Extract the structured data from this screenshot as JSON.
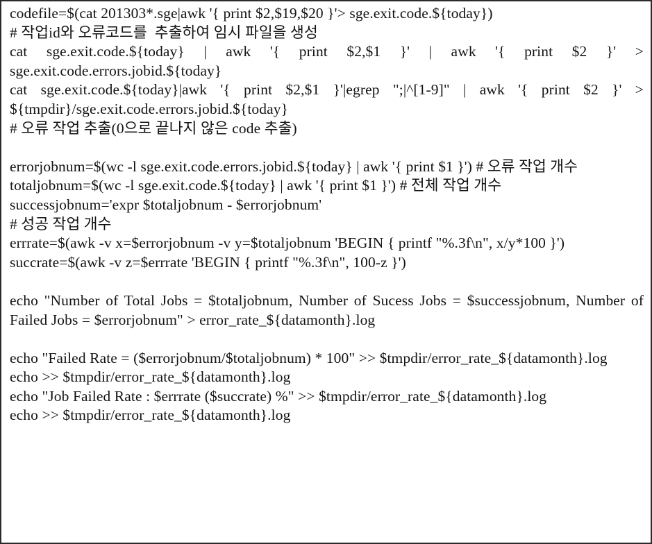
{
  "document": {
    "type": "scanned-code-listing",
    "language": "shell",
    "border_color": "#2b2b2b",
    "background_color": "#ffffff",
    "text_color": "#141414"
  },
  "code": {
    "lines": [
      {
        "id": "line-1",
        "kind": "command",
        "justified": true,
        "text": "codefile=$(cat 201303*.sge|awk '{ print $2,$19,$20 }'> sge.exit.code.${today})"
      },
      {
        "id": "line-2",
        "kind": "comment",
        "justified": false,
        "text": "# 작업id와 오류코드를  추출하여 임시 파일을 생성"
      },
      {
        "id": "line-3",
        "kind": "command",
        "justified": true,
        "text": "cat   sge.exit.code.${today}  |  awk  '{  print  $2,$1  }'  |  awk  '{  print  $2  }'  > sge.exit.code.errors.jobid.${today}"
      },
      {
        "id": "line-4",
        "kind": "command",
        "justified": true,
        "text": "cat  sge.exit.code.${today}|awk  '{  print  $2,$1  }'|egrep  \";|^[1-9]\"  |  awk  '{  print  $2  }'  > ${tmpdir}/sge.exit.code.errors.jobid.${today}"
      },
      {
        "id": "line-5",
        "kind": "comment",
        "justified": false,
        "text": "# 오류 작업 추출(0으로 끝나지 않은 code 추출)"
      },
      {
        "id": "line-6",
        "kind": "blank",
        "justified": false,
        "text": ""
      },
      {
        "id": "line-7",
        "kind": "command",
        "justified": true,
        "text": "errorjobnum=$(wc  -l  sge.exit.code.errors.jobid.${today}  |  awk  '{  print  $1  }')  # 오류 작업 개수"
      },
      {
        "id": "line-8",
        "kind": "command",
        "justified": true,
        "text": "totaljobnum=$(wc  -l  sge.exit.code.${today}  |  awk  '{  print  $1  }')  # 전체 작업 개수"
      },
      {
        "id": "line-9",
        "kind": "command",
        "justified": false,
        "text": "successjobnum='expr $totaljobnum - $errorjobnum'"
      },
      {
        "id": "line-10",
        "kind": "comment",
        "justified": false,
        "text": "# 성공 작업 개수"
      },
      {
        "id": "line-11",
        "kind": "command",
        "justified": true,
        "text": "errrate=$(awk  -v  x=$errorjobnum  -v  y=$totaljobnum  'BEGIN  {  printf  \"%.3f\\n\", x/y*100 }')"
      },
      {
        "id": "line-12",
        "kind": "command",
        "justified": false,
        "text": "succrate=$(awk -v z=$errrate 'BEGIN { printf \"%.3f\\n\", 100-z }')"
      },
      {
        "id": "line-13",
        "kind": "blank",
        "justified": false,
        "text": ""
      },
      {
        "id": "line-14",
        "kind": "command",
        "justified": true,
        "text": "echo  \"Number  of  Total  Jobs  =  $totaljobnum,  Number  of  Sucess  Jobs  = $successjobnum,  Number  of  Failed  Jobs  =  $errorjobnum\"  > error_rate_${datamonth}.log"
      },
      {
        "id": "line-15",
        "kind": "blank",
        "justified": false,
        "text": ""
      },
      {
        "id": "line-16",
        "kind": "command",
        "justified": true,
        "text": "echo  \"Failed  Rate  =  ($errorjobnum/$totaljobnum)  *  100\"  >> $tmpdir/error_rate_${datamonth}.log"
      },
      {
        "id": "line-17",
        "kind": "command",
        "justified": false,
        "text": "echo >> $tmpdir/error_rate_${datamonth}.log"
      },
      {
        "id": "line-18",
        "kind": "command",
        "justified": true,
        "text": "echo  \"Job  Failed  Rate  :  $errrate  ($succrate)  %\"  >> $tmpdir/error_rate_${datamonth}.log"
      },
      {
        "id": "line-19",
        "kind": "command",
        "justified": false,
        "text": "echo >> $tmpdir/error_rate_${datamonth}.log"
      }
    ]
  }
}
